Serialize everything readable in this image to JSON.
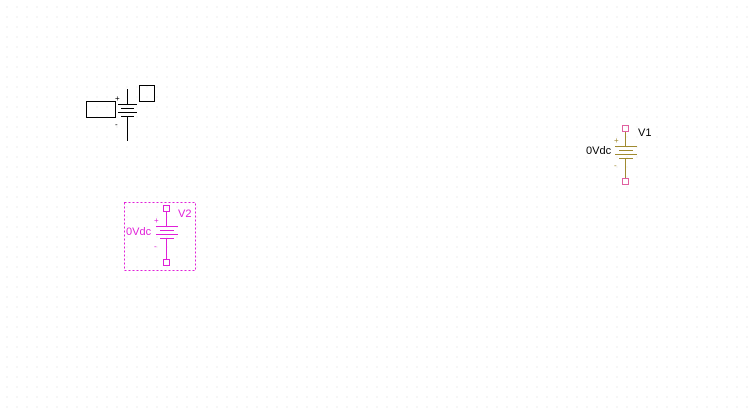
{
  "colors": {
    "ghost": "#000000",
    "placed": "#a08a30",
    "selected": "#e020d8",
    "placed_pin": "#e060a0",
    "grid_dot": "#d9d9d9"
  },
  "parts": {
    "v1": {
      "refdes": "V1",
      "value": "0Vdc",
      "pin_plus": "+",
      "pin_minus": "-"
    },
    "v2": {
      "refdes": "V2",
      "value": "0Vdc",
      "pin_plus": "+",
      "pin_minus": "-",
      "selected": true
    },
    "ghost": {
      "pin_plus": "+",
      "pin_minus": "-"
    }
  }
}
